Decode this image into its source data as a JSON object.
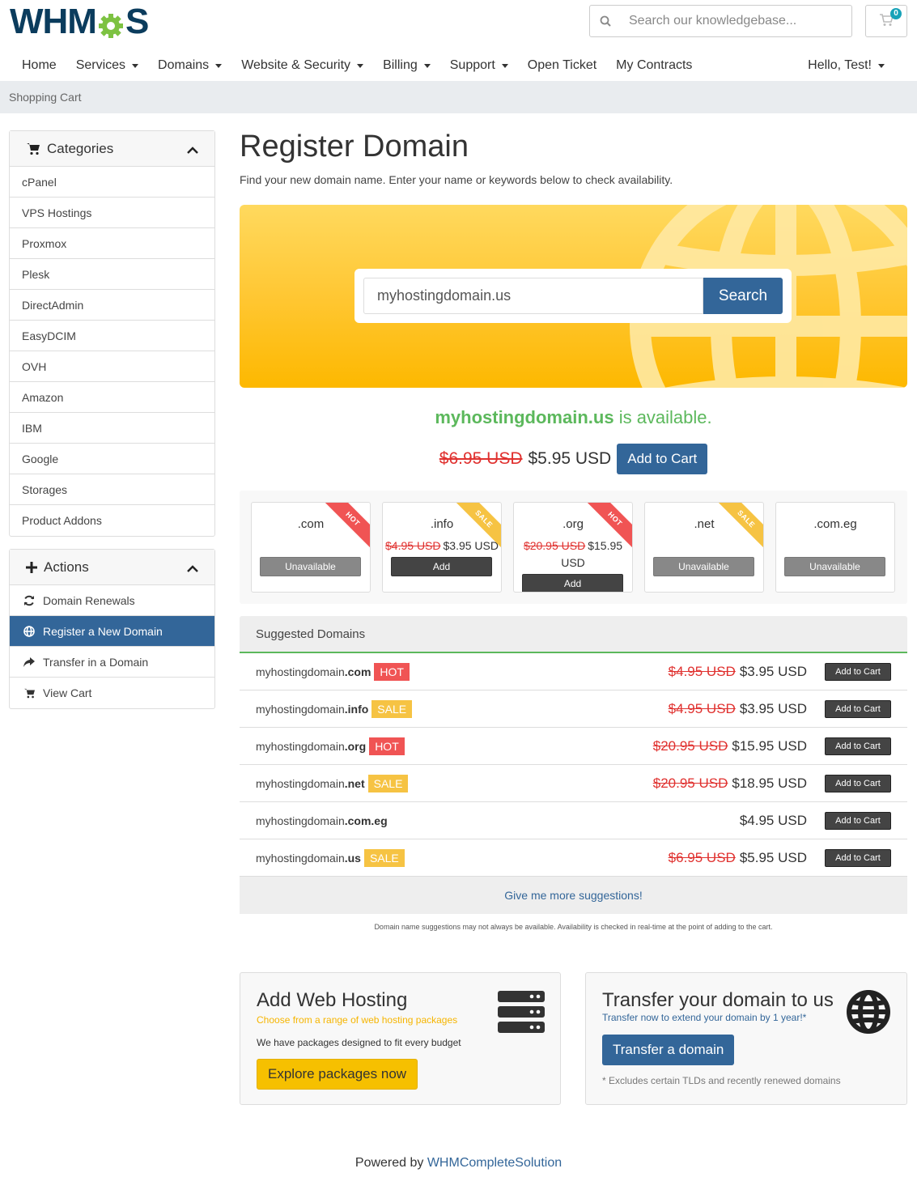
{
  "header": {
    "logo_text_left": "WHM",
    "logo_text_right": "S",
    "kb_search_placeholder": "Search our knowledgebase...",
    "cart_count": "0"
  },
  "nav": {
    "items": [
      {
        "label": "Home",
        "dropdown": false
      },
      {
        "label": "Services",
        "dropdown": true
      },
      {
        "label": "Domains",
        "dropdown": true
      },
      {
        "label": "Website & Security",
        "dropdown": true
      },
      {
        "label": "Billing",
        "dropdown": true
      },
      {
        "label": "Support",
        "dropdown": true
      },
      {
        "label": "Open Ticket",
        "dropdown": false
      },
      {
        "label": "My Contracts",
        "dropdown": false
      }
    ],
    "user": "Hello, Test!"
  },
  "breadcrumb": "Shopping Cart",
  "sidebar": {
    "categories_title": "Categories",
    "categories": [
      "cPanel",
      "VPS Hostings",
      "Proxmox",
      "Plesk",
      "DirectAdmin",
      "EasyDCIM",
      "OVH",
      "Amazon",
      "IBM",
      "Google",
      "Storages",
      "Product Addons"
    ],
    "actions_title": "Actions",
    "actions": [
      {
        "label": "Domain Renewals",
        "icon": "refresh-icon",
        "active": false
      },
      {
        "label": "Register a New Domain",
        "icon": "globe-icon",
        "active": true
      },
      {
        "label": "Transfer in a Domain",
        "icon": "share-icon",
        "active": false
      },
      {
        "label": "View Cart",
        "icon": "cart-icon",
        "active": false
      }
    ]
  },
  "main": {
    "title": "Register Domain",
    "subtitle": "Find your new domain name. Enter your name or keywords below to check availability.",
    "search_value": "myhostingdomain.us",
    "search_button": "Search",
    "available_domain": "myhostingdomain.us",
    "available_suffix": " is available.",
    "old_price": "$6.95 USD",
    "new_price": "$5.95 USD",
    "add_to_cart": "Add to Cart"
  },
  "tlds": [
    {
      "name": ".com",
      "ribbon": "HOT",
      "ribbon_type": "hot",
      "old_price": "",
      "price": "",
      "button": "Unavailable",
      "available": false
    },
    {
      "name": ".info",
      "ribbon": "SALE",
      "ribbon_type": "sale",
      "old_price": "$4.95 USD",
      "price": "$3.95 USD",
      "button": "Add",
      "available": true
    },
    {
      "name": ".org",
      "ribbon": "HOT",
      "ribbon_type": "hot",
      "old_price": "$20.95 USD",
      "price": "$15.95 USD",
      "button": "Add",
      "available": true
    },
    {
      "name": ".net",
      "ribbon": "SALE",
      "ribbon_type": "sale",
      "old_price": "",
      "price": "",
      "button": "Unavailable",
      "available": false
    },
    {
      "name": ".com.eg",
      "ribbon": "",
      "ribbon_type": "",
      "old_price": "",
      "price": "",
      "button": "Unavailable",
      "available": false
    }
  ],
  "suggested": {
    "title": "Suggested Domains",
    "rows": [
      {
        "sld": "myhostingdomain",
        "tld": ".com",
        "tag": "HOT",
        "tag_type": "hot",
        "old_price": "$4.95 USD",
        "price": "$3.95 USD"
      },
      {
        "sld": "myhostingdomain",
        "tld": ".info",
        "tag": "SALE",
        "tag_type": "sale",
        "old_price": "$4.95 USD",
        "price": "$3.95 USD"
      },
      {
        "sld": "myhostingdomain",
        "tld": ".org",
        "tag": "HOT",
        "tag_type": "hot",
        "old_price": "$20.95 USD",
        "price": "$15.95 USD"
      },
      {
        "sld": "myhostingdomain",
        "tld": ".net",
        "tag": "SALE",
        "tag_type": "sale",
        "old_price": "$20.95 USD",
        "price": "$18.95 USD"
      },
      {
        "sld": "myhostingdomain",
        "tld": ".com.eg",
        "tag": "",
        "tag_type": "",
        "old_price": "",
        "price": "$4.95 USD"
      },
      {
        "sld": "myhostingdomain",
        "tld": ".us",
        "tag": "SALE",
        "tag_type": "sale",
        "old_price": "$6.95 USD",
        "price": "$5.95 USD"
      }
    ],
    "row_button": "Add to Cart",
    "more": "Give me more suggestions!",
    "note": "Domain name suggestions may not always be available. Availability is checked in real-time at the point of adding to the cart."
  },
  "promos": {
    "hosting": {
      "title": "Add Web Hosting",
      "subtitle": "Choose from a range of web hosting packages",
      "desc": "We have packages designed to fit every budget",
      "button": "Explore packages now"
    },
    "transfer": {
      "title": "Transfer your domain to us",
      "subtitle": "Transfer now to extend your domain by 1 year!*",
      "button": "Transfer a domain",
      "footnote": "* Excludes certain TLDs and recently renewed domains"
    }
  },
  "footer": {
    "prefix": "Powered by ",
    "link": "WHMCompleteSolution"
  },
  "colors": {
    "primary": "#336699",
    "success": "#5cb85c",
    "danger": "#e0312f",
    "hot": "#f05454",
    "sale": "#f6c343",
    "hero": "#ffc733"
  }
}
